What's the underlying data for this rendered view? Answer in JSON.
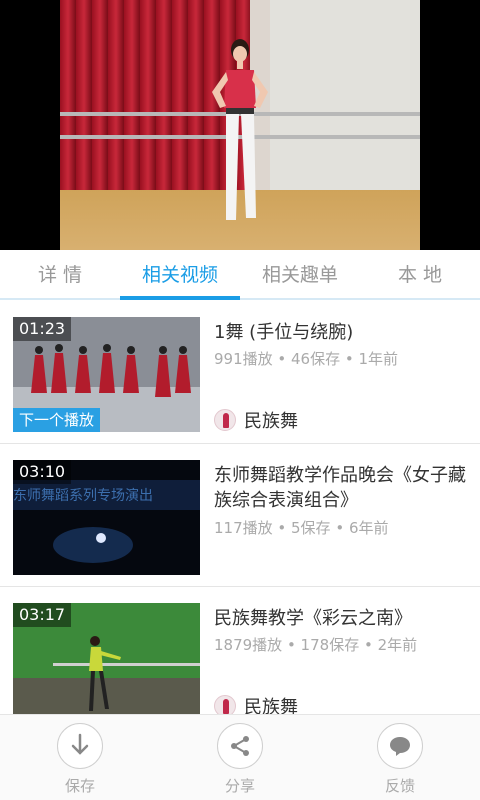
{
  "tabs": [
    {
      "label": "详 情"
    },
    {
      "label": "相关视频"
    },
    {
      "label": "相关趣单"
    },
    {
      "label": "本 地"
    }
  ],
  "active_tab_index": 1,
  "accent_color": "#1a9de6",
  "videos": [
    {
      "duration": "01:23",
      "badge": "下一个播放",
      "title": "1舞 (手位与绕腕)",
      "meta": "991播放 • 46保存 • 1年前",
      "channel": "民族舞"
    },
    {
      "duration": "03:10",
      "title": "东师舞蹈教学作品晚会《女子藏族综合表演组合》",
      "meta": "117播放 • 5保存 • 6年前",
      "thumb_caption": "东师舞蹈系列专场演出"
    },
    {
      "duration": "03:17",
      "title": "民族舞教学《彩云之南》",
      "meta": "1879播放 • 178保存 • 2年前",
      "channel": "民族舞"
    }
  ],
  "actions": [
    {
      "label": "保存",
      "icon": "download-icon"
    },
    {
      "label": "分享",
      "icon": "share-icon"
    },
    {
      "label": "反馈",
      "icon": "feedback-icon"
    }
  ]
}
